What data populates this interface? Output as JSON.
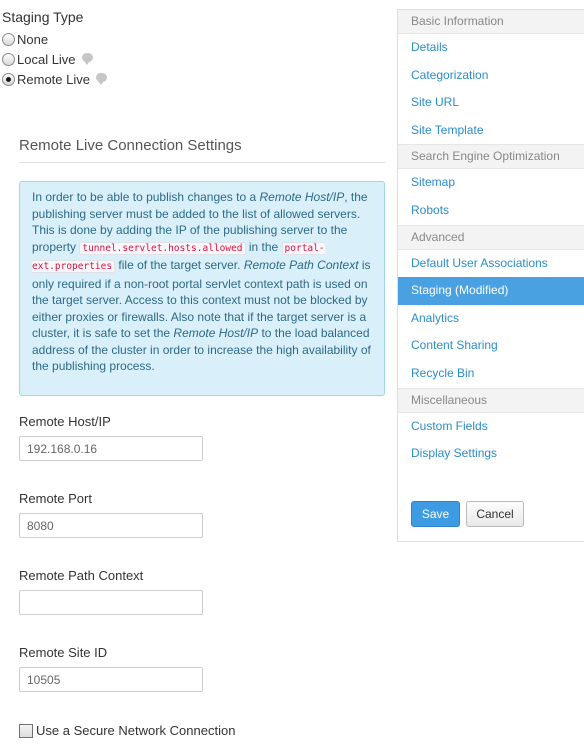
{
  "staging_type": {
    "title": "Staging Type",
    "options": [
      {
        "label": "None",
        "checked": false
      },
      {
        "label": "Local Live",
        "checked": false,
        "help": "help-icon"
      },
      {
        "label": "Remote Live",
        "checked": true,
        "help": "help-icon"
      }
    ]
  },
  "main": {
    "section_title": "Remote Live Connection Settings",
    "alert": {
      "t1": "In order to be able to publish changes to a ",
      "em1": "Remote Host/IP",
      "t2": ", the publishing server must be added to the list of allowed servers. This is done by adding the IP of the publishing server to the property ",
      "code1": "tunnel.servlet.hosts.allowed",
      "t3": " in the ",
      "code2": "portal-ext.properties",
      "t4": " file of the target server. ",
      "em2": "Remote Path Context",
      "t5": " is only required if a non-root portal servlet context path is used on the target server. Access to this context must not be blocked by either proxies or firewalls. Also note that if the target server is a cluster, it is safe to set the ",
      "em3": "Remote Host/IP",
      "t6": " to the load balanced address of the cluster in order to increase the high availability of the publishing process."
    },
    "fields": {
      "host": {
        "label": "Remote Host/IP",
        "value": "192.168.0.16"
      },
      "port": {
        "label": "Remote Port",
        "value": "8080"
      },
      "path": {
        "label": "Remote Path Context",
        "value": ""
      },
      "site_id": {
        "label": "Remote Site ID",
        "value": "10505"
      }
    },
    "secure_label": "Use a Secure Network Connection"
  },
  "sidebar": {
    "basic": {
      "header": "Basic Information",
      "items": [
        "Details",
        "Categorization",
        "Site URL",
        "Site Template"
      ]
    },
    "seo": {
      "header": "Search Engine Optimization",
      "items": [
        "Sitemap",
        "Robots"
      ]
    },
    "advanced": {
      "header": "Advanced",
      "items": [
        "Default User Associations",
        "Staging (Modified)",
        "Analytics",
        "Content Sharing",
        "Recycle Bin"
      ],
      "active": "Staging (Modified)"
    },
    "misc": {
      "header": "Miscellaneous",
      "items": [
        "Custom Fields",
        "Display Settings"
      ]
    },
    "buttons": {
      "save": "Save",
      "cancel": "Cancel"
    }
  },
  "colors": {
    "link": "#2a8dc9",
    "active_bg": "#4aa1e1",
    "alert_bg": "#d9f0fa",
    "save_bg": "#3d9be3"
  }
}
